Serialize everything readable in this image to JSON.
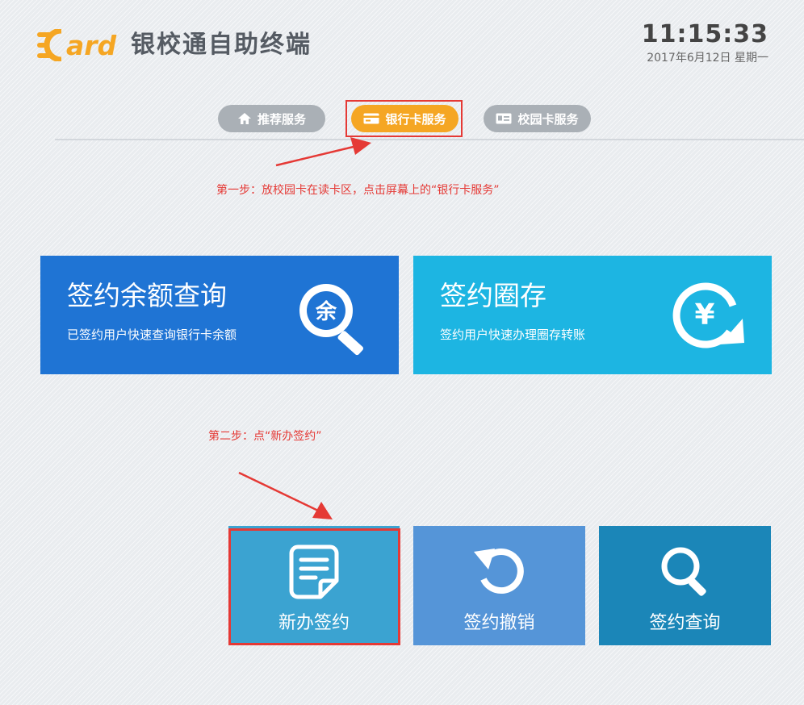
{
  "header": {
    "logo_text": "ard",
    "title": "银校通自助终端",
    "time": "11:15:33",
    "date": "2017年6月12日 星期一"
  },
  "tabs": [
    {
      "label": "推荐服务",
      "icon": "home-icon",
      "active": false
    },
    {
      "label": "银行卡服务",
      "icon": "bank-card-icon",
      "active": true
    },
    {
      "label": "校园卡服务",
      "icon": "id-card-icon",
      "active": false
    }
  ],
  "annotations": {
    "step1": "第一步：放校园卡在读卡区，点击屏幕上的“银行卡服务”",
    "step2": "第二步：点“新办签约”"
  },
  "cards": [
    {
      "title": "签约余额查询",
      "desc": "已签约用户快速查询银行卡余额",
      "icon": "balance-search-icon",
      "icon_char": "余",
      "color": "#1f74d4"
    },
    {
      "title": "签约圈存",
      "desc": "签约用户快速办理圈存转账",
      "icon": "yuan-transfer-icon",
      "icon_char": "¥",
      "color": "#1db5e2"
    }
  ],
  "tiles": [
    {
      "label": "新办签约",
      "icon": "document-icon",
      "color": "#3ba3d1"
    },
    {
      "label": "签约撤销",
      "icon": "undo-icon",
      "color": "#5595d8"
    },
    {
      "label": "签约查询",
      "icon": "search-icon",
      "color": "#1b86b8"
    }
  ],
  "colors": {
    "accent_orange": "#f5a623",
    "tab_inactive": "#aab0b6",
    "highlight_red": "#e53935"
  }
}
